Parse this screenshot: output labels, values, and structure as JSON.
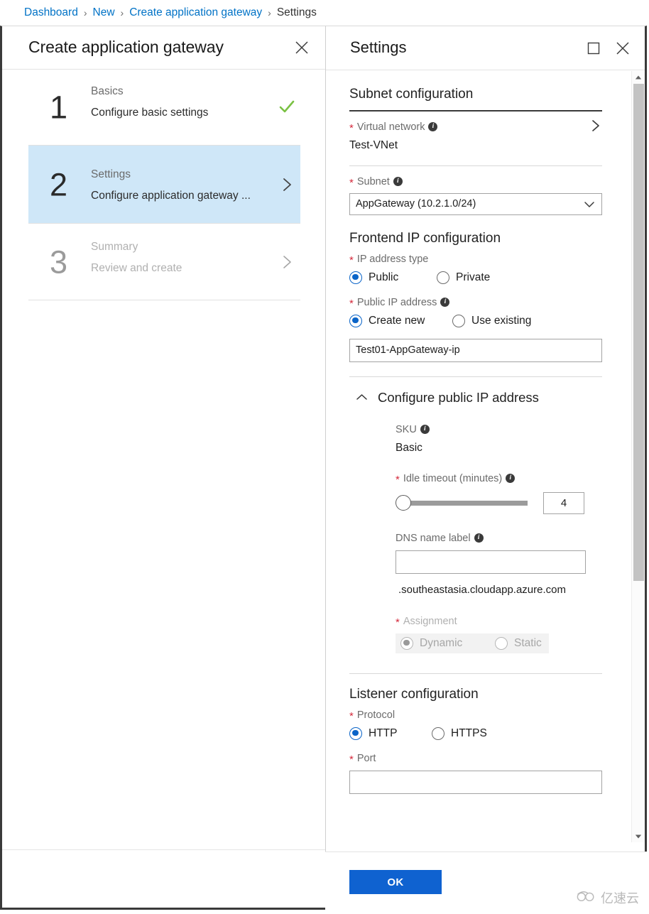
{
  "breadcrumb": {
    "items": [
      {
        "label": "Dashboard",
        "type": "link"
      },
      {
        "label": "New",
        "type": "link"
      },
      {
        "label": "Create application gateway",
        "type": "link"
      },
      {
        "label": "Settings",
        "type": "current"
      }
    ],
    "separator": "›"
  },
  "left_blade": {
    "title": "Create application gateway",
    "close_icon": "close-icon",
    "steps": [
      {
        "number": "1",
        "title": "Basics",
        "subtitle": "Configure basic settings",
        "state": "done",
        "indicator": "check-icon"
      },
      {
        "number": "2",
        "title": "Settings",
        "subtitle": "Configure application gateway ...",
        "state": "active",
        "indicator": "chevron-right-icon"
      },
      {
        "number": "3",
        "title": "Summary",
        "subtitle": "Review and create",
        "state": "disabled",
        "indicator": "chevron-right-icon"
      }
    ]
  },
  "settings_blade": {
    "title": "Settings",
    "maximize_icon": "maximize-icon",
    "close_icon": "close-icon",
    "scrollbar": {
      "up_icon": "scroll-up-arrow-icon",
      "down_icon": "scroll-down-arrow-icon"
    },
    "subnet_section": {
      "heading": "Subnet configuration",
      "virtual_network": {
        "label": "Virtual network",
        "required": "*",
        "info_icon": "info-icon",
        "value": "Test-VNet",
        "chevron_icon": "chevron-right-icon"
      },
      "subnet": {
        "label": "Subnet",
        "required": "*",
        "info_icon": "info-icon",
        "selected": "AppGateway (10.2.1.0/24)",
        "options": [
          "AppGateway (10.2.1.0/24)"
        ],
        "chevron_icon": "chevron-down-icon"
      }
    },
    "frontend_section": {
      "heading": "Frontend IP configuration",
      "ip_address_type": {
        "label": "IP address type",
        "required": "*",
        "options": [
          {
            "label": "Public",
            "selected": true
          },
          {
            "label": "Private",
            "selected": false
          }
        ]
      },
      "public_ip_address": {
        "label": "Public IP address",
        "required": "*",
        "info_icon": "info-icon",
        "options": [
          {
            "label": "Create new",
            "selected": true
          },
          {
            "label": "Use existing",
            "selected": false
          }
        ],
        "name_value": "Test01-AppGateway-ip",
        "name_placeholder": ""
      },
      "configure_public_ip": {
        "expander_label": "Configure public IP address",
        "expanded": true,
        "caret_icon": "chevron-up-icon",
        "sku": {
          "label": "SKU",
          "info_icon": "info-icon",
          "value": "Basic"
        },
        "idle_timeout": {
          "label": "Idle timeout (minutes)",
          "required": "*",
          "info_icon": "info-icon",
          "value": "4",
          "slider_position_percent": 0
        },
        "dns_name_label": {
          "label": "DNS name label",
          "info_icon": "info-icon",
          "value": "",
          "placeholder": "",
          "suffix": ".southeastasia.cloudapp.azure.com"
        },
        "assignment": {
          "label": "Assignment",
          "required": "*",
          "disabled": true,
          "options": [
            {
              "label": "Dynamic",
              "selected": true
            },
            {
              "label": "Static",
              "selected": false
            }
          ]
        }
      }
    },
    "listener_section": {
      "heading": "Listener configuration",
      "protocol": {
        "label": "Protocol",
        "required": "*",
        "options": [
          {
            "label": "HTTP",
            "selected": true
          },
          {
            "label": "HTTPS",
            "selected": false
          }
        ]
      },
      "port": {
        "label": "Port",
        "required": "*"
      }
    },
    "footer": {
      "ok_label": "OK"
    }
  },
  "watermark": {
    "text": "亿速云",
    "icon": "cloud-logo-icon"
  },
  "colors": {
    "link": "#0072c6",
    "accent_blue": "#0a64c8",
    "ok_button": "#0f62d0",
    "active_step_bg": "#cfe7f8",
    "check_green": "#7ac143",
    "required_red": "#d42a3c"
  }
}
